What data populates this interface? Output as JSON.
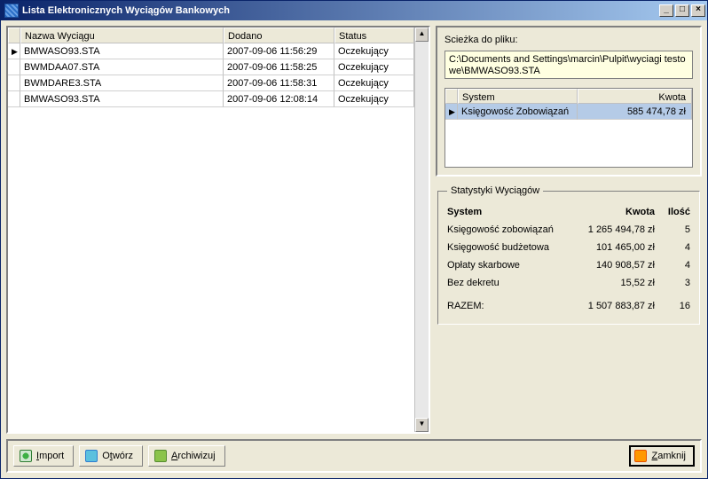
{
  "window": {
    "title": "Lista Elektronicznych Wyciągów Bankowych"
  },
  "grid": {
    "headers": {
      "name": "Nazwa Wyciągu",
      "added": "Dodano",
      "status": "Status"
    },
    "rows": [
      {
        "name": "BMWASO93.STA",
        "added": "2007-09-06 11:56:29",
        "status": "Oczekujący"
      },
      {
        "name": "BWMDAA07.STA",
        "added": "2007-09-06 11:58:25",
        "status": "Oczekujący"
      },
      {
        "name": "BWMDARE3.STA",
        "added": "2007-09-06 11:58:31",
        "status": "Oczekujący"
      },
      {
        "name": "BMWASO93.STA",
        "added": "2007-09-06 12:08:14",
        "status": "Oczekujący"
      }
    ]
  },
  "path": {
    "label": "Scieżka do pliku:",
    "value": "C:\\Documents and Settings\\marcin\\Pulpit\\wyciagi testowe\\BMWASO93.STA"
  },
  "subgrid": {
    "headers": {
      "system": "System",
      "amount": "Kwota"
    },
    "rows": [
      {
        "system": "Księgowość Zobowiązań",
        "amount": "585 474,78 zł"
      }
    ]
  },
  "stats": {
    "title": "Statystyki Wyciągów",
    "headers": {
      "system": "System",
      "amount": "Kwota",
      "count": "Ilość"
    },
    "rows": [
      {
        "system": "Księgowość zobowiązań",
        "amount": "1 265 494,78 zł",
        "count": "5"
      },
      {
        "system": "Księgowość budżetowa",
        "amount": "101 465,00 zł",
        "count": "4"
      },
      {
        "system": "Opłaty skarbowe",
        "amount": "140 908,57 zł",
        "count": "4"
      },
      {
        "system": "Bez dekretu",
        "amount": "15,52 zł",
        "count": "3"
      }
    ],
    "total": {
      "label": "RAZEM:",
      "amount": "1 507 883,87 zł",
      "count": "16"
    }
  },
  "buttons": {
    "import": "Import",
    "open": "Otwórz",
    "archive": "Archiwizuj",
    "close": "Zamknij"
  }
}
